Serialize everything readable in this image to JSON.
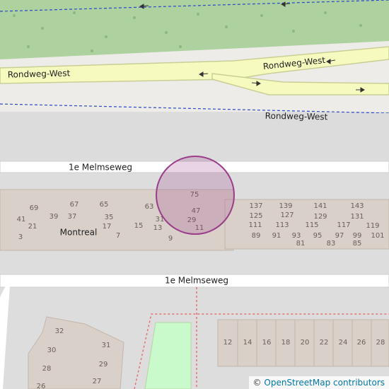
{
  "map": {
    "roads": {
      "rondweg_west": "Rondweg-West",
      "melmseweg": "1e Melmseweg"
    },
    "area_label": "Montreal",
    "house_numbers_left": [
      "69",
      "67",
      "65",
      "41",
      "39",
      "37",
      "35",
      "21",
      "17",
      "15",
      "3",
      "7",
      "63",
      "31",
      "13",
      "9",
      "75",
      "47",
      "29",
      "11"
    ],
    "house_numbers_right": [
      "137",
      "139",
      "141",
      "143",
      "125",
      "127",
      "129",
      "131",
      "111",
      "113",
      "115",
      "117",
      "119",
      "89",
      "91",
      "93",
      "95",
      "97",
      "99",
      "101",
      "81",
      "83",
      "85"
    ],
    "house_numbers_south": [
      "32",
      "31",
      "30",
      "29",
      "28",
      "27",
      "26",
      "12",
      "14",
      "16",
      "18",
      "20",
      "22",
      "24",
      "26",
      "28"
    ],
    "marker_color": "#9b3d8a",
    "colors": {
      "grass": "#aed1a0",
      "trunk_road": "#f7fabf",
      "buildings": "#d9d0c9",
      "service_area": "#eeece8",
      "park": "#c8facc"
    }
  },
  "attribution": {
    "symbol": "©",
    "text": "OpenStreetMap contributors"
  }
}
